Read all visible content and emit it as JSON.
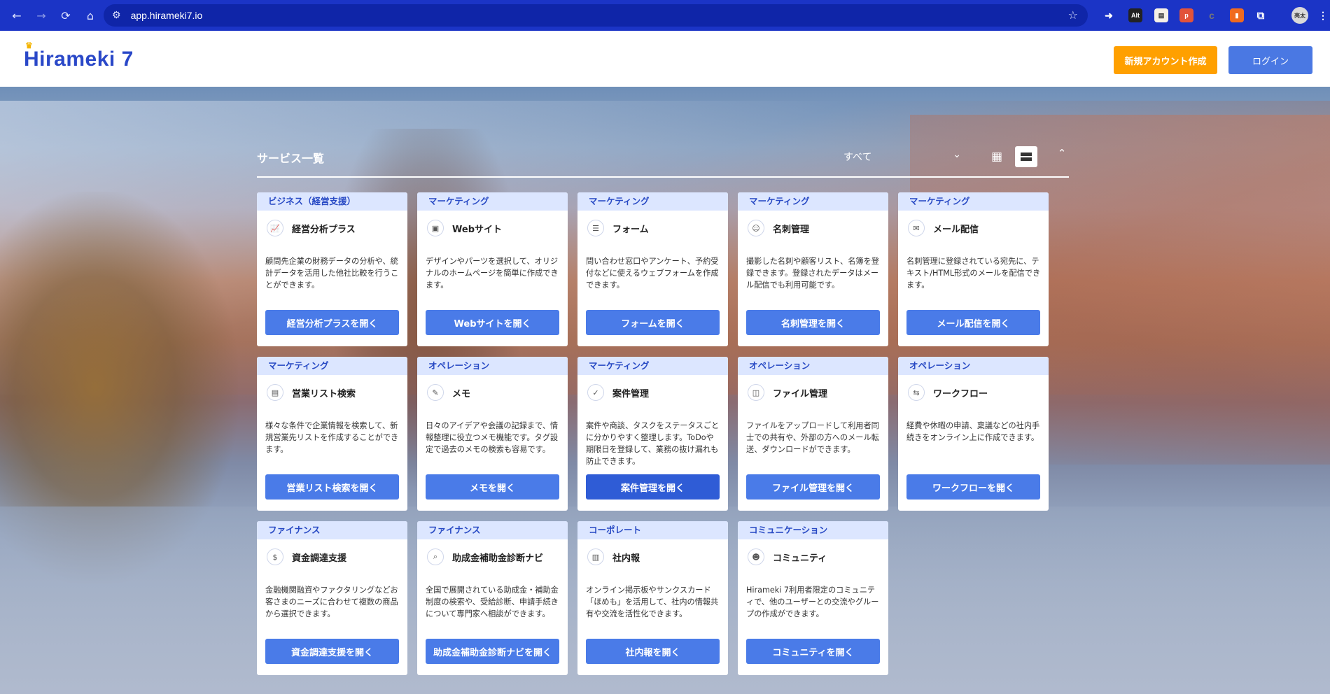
{
  "browser": {
    "url": "app.hirameki7.io",
    "extensions": [
      {
        "name": "ext-arrow-icon",
        "label": "",
        "color": "#ffffff"
      },
      {
        "name": "ext-alt-icon",
        "label": "Alt",
        "color": "#333333"
      },
      {
        "name": "ext-note-icon",
        "label": "",
        "color": "#f5f0e6"
      },
      {
        "name": "ext-p-icon",
        "label": "p",
        "color": "#e2533a"
      },
      {
        "name": "ext-c-icon",
        "label": "c",
        "color": "#555555"
      },
      {
        "name": "ext-orange-icon",
        "label": "",
        "color": "#f06a1f"
      },
      {
        "name": "ext-puzzle-icon",
        "label": "",
        "color": "#ffffff"
      }
    ],
    "profile_label": "亮太"
  },
  "header": {
    "logo_text": "Hirameki 7",
    "signup_label": "新規アカウント作成",
    "login_label": "ログイン"
  },
  "panel": {
    "title": "サービス一覧",
    "filter_value": "すべて"
  },
  "cards": [
    {
      "category": "ビジネス（経営支援）",
      "icon": "chart-icon",
      "title": "経営分析プラス",
      "description": "顧問先企業の財務データの分析や、統計データを活用した他社比較を行うことができます。",
      "button": "経営分析プラスを開く"
    },
    {
      "category": "マーケティング",
      "icon": "browser-icon",
      "title": "Webサイト",
      "description": "デザインやパーツを選択して、オリジナルのホームページを簡単に作成できます。",
      "button": "Webサイトを開く"
    },
    {
      "category": "マーケティング",
      "icon": "form-icon",
      "title": "フォーム",
      "description": "問い合わせ窓口やアンケート、予約受付などに使えるウェブフォームを作成できます。",
      "button": "フォームを開く"
    },
    {
      "category": "マーケティング",
      "icon": "business-card-icon",
      "title": "名刺管理",
      "description": "撮影した名刺や顧客リスト、名簿を登録できます。登録されたデータはメール配信でも利用可能です。",
      "button": "名刺管理を開く"
    },
    {
      "category": "マーケティング",
      "icon": "mail-icon",
      "title": "メール配信",
      "description": "名刺管理に登録されている宛先に、テキスト/HTML形式のメールを配信できます。",
      "button": "メール配信を開く"
    },
    {
      "category": "マーケティング",
      "icon": "search-list-icon",
      "title": "営業リスト検索",
      "description": "様々な条件で企業情報を検索して、新規営業先リストを作成することができます。",
      "button": "営業リスト検索を開く"
    },
    {
      "category": "オペレーション",
      "icon": "memo-icon",
      "title": "メモ",
      "description": "日々のアイデアや会議の記録まで、情報整理に役立つメモ機能です。タグ設定で過去のメモの検索も容易です。",
      "button": "メモを開く"
    },
    {
      "category": "マーケティング",
      "icon": "task-icon",
      "title": "案件管理",
      "description": "案件や商談、タスクをステータスごとに分かりやすく整理します。ToDoや期限日を登録して、業務の抜け漏れも防止できます。",
      "button": "案件管理を開く"
    },
    {
      "category": "オペレーション",
      "icon": "file-box-icon",
      "title": "ファイル管理",
      "description": "ファイルをアップロードして利用者同士での共有や、外部の方へのメール転送、ダウンロードができます。",
      "button": "ファイル管理を開く"
    },
    {
      "category": "オペレーション",
      "icon": "workflow-icon",
      "title": "ワークフロー",
      "description": "経費や休暇の申請、稟議などの社内手続きをオンライン上に作成できます。",
      "button": "ワークフローを開く"
    },
    {
      "category": "ファイナンス",
      "icon": "money-bag-icon",
      "title": "資金調達支援",
      "description": "金融機関融資やファクタリングなどお客さまのニーズに合わせて複数の商品から選択できます。",
      "button": "資金調達支援を開く"
    },
    {
      "category": "ファイナンス",
      "icon": "search-icon",
      "title": "助成金補助金診断ナビ",
      "description": "全国で展開されている助成金・補助金制度の検索や、受給診断、申請手続きについて専門家へ相談ができます。",
      "button": "助成金補助金診断ナビを開く"
    },
    {
      "category": "コーポレート",
      "icon": "newsletter-icon",
      "title": "社内報",
      "description": "オンライン掲示板やサンクスカード「ほめも」を活用して、社内の情報共有や交流を活性化できます。",
      "button": "社内報を開く"
    },
    {
      "category": "コミュニケーション",
      "icon": "community-icon",
      "title": "コミュニティ",
      "description": "Hirameki 7利用者限定のコミュニティで、他のユーザーとの交流やグループの作成ができます。",
      "button": "コミュニティを開く"
    }
  ]
}
